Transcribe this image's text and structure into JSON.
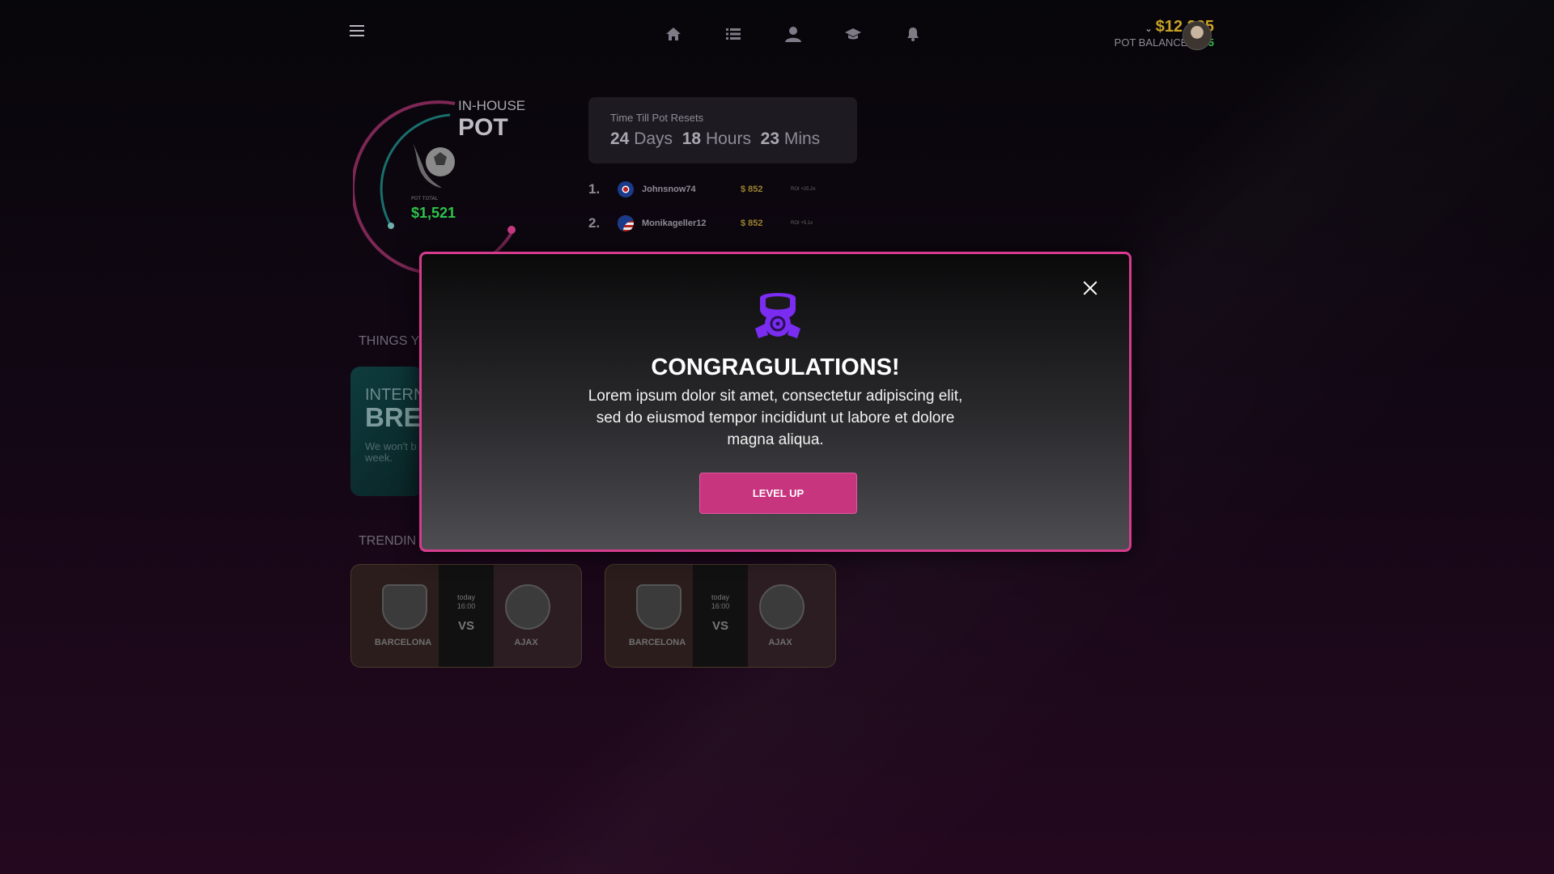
{
  "header": {
    "balance": "$12,225",
    "pot_balance_label": "POT BALANCE",
    "pot_balance_value": "$235"
  },
  "pot": {
    "label_small": "IN-HOUSE",
    "label_large": "POT",
    "total_label": "POT TOTAL",
    "total_value": "$1,521"
  },
  "timer": {
    "title": "Time Till Pot Resets",
    "days_num": "24",
    "days_unit": "Days",
    "hours_num": "18",
    "hours_unit": "Hours",
    "mins_num": "23",
    "mins_unit": "Mins"
  },
  "leaderboard": [
    {
      "rank": "1.",
      "flag": "uk",
      "name": "Johnsnow74",
      "amount": "$ 852",
      "roi": "ROI +25.2x"
    },
    {
      "rank": "2.",
      "flag": "us",
      "name": "Monikageller12",
      "amount": "$ 852",
      "roi": "ROI +5.1x"
    }
  ],
  "sections": {
    "things_title": "THINGS Y",
    "trending_title": "TRENDIN"
  },
  "promo_card": {
    "line1": "INTERN",
    "line2": "BRE",
    "body": "We won't b a lot of gam next week."
  },
  "matches": [
    {
      "home": "BARCELONA",
      "away": "AJAX",
      "day": "today",
      "time": "16:00",
      "vs": "VS"
    },
    {
      "home": "BARCELONA",
      "away": "AJAX",
      "day": "today",
      "time": "16:00",
      "vs": "VS"
    }
  ],
  "modal": {
    "title": "CONGRAGULATIONS!",
    "body": "Lorem ipsum dolor sit amet, consectetur adipiscing elit, sed do eiusmod tempor incididunt ut labore et dolore magna aliqua.",
    "button": "LEVEL UP",
    "icon": "gas-mask-icon"
  },
  "colors": {
    "accent": "#d63b8e",
    "button": "#c8357f",
    "gold": "#c9a227",
    "green": "#2ec34a",
    "icon_purple": "#7a2cf0"
  }
}
